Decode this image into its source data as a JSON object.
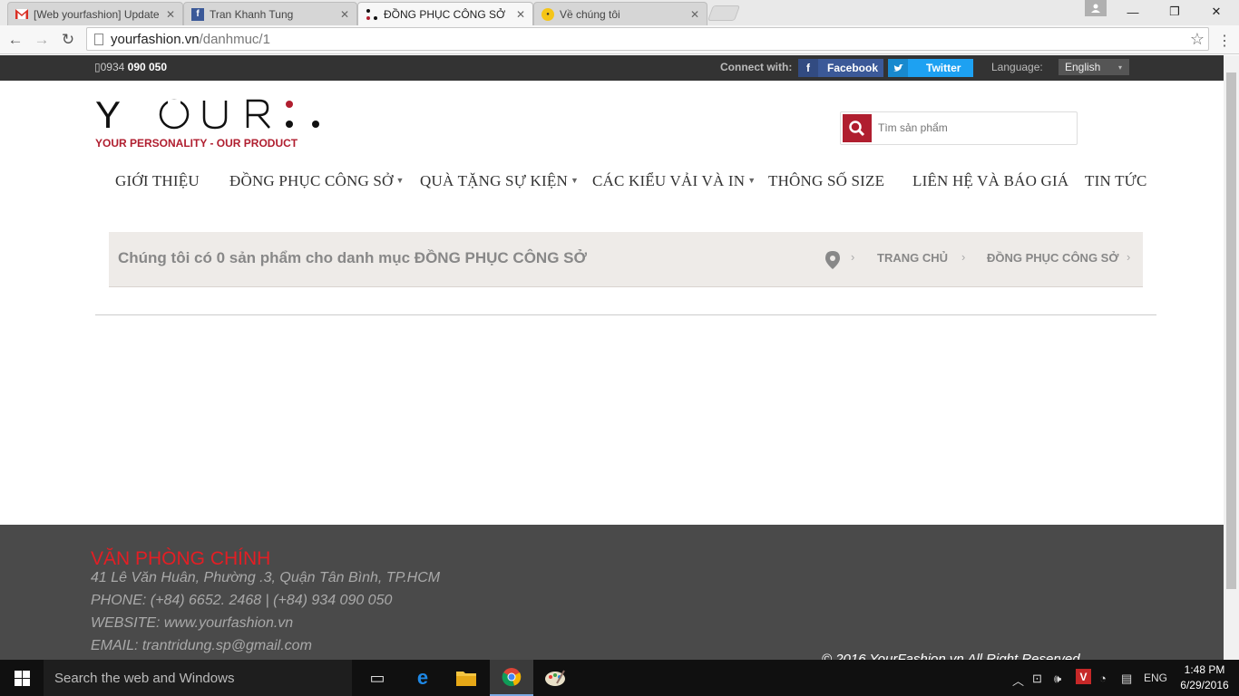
{
  "browser": {
    "tabs": [
      {
        "label": "[Web yourfashion] Update",
        "icon": "gmail-icon"
      },
      {
        "label": "Tran Khanh Tung",
        "icon": "facebook-icon"
      },
      {
        "label": "ĐỒNG PHỤC CÔNG SỞ",
        "icon": "site-logo-icon"
      },
      {
        "label": "Về chúng tôi",
        "icon": "site-icon"
      }
    ],
    "address": {
      "host": "yourfashion.vn",
      "path": "/danhmuc/1"
    }
  },
  "topbar": {
    "phone_prefix": "0934",
    "phone_suffix": "090 050",
    "connect_label": "Connect with:",
    "facebook_label": "Facebook",
    "twitter_label": "Twitter",
    "language_label": "Language:",
    "language_value": "English"
  },
  "logo": {
    "text": "YOUR",
    "tagline": "YOUR PERSONALITY - OUR PRODUCT"
  },
  "search": {
    "placeholder": "Tìm sản phẩm"
  },
  "nav": {
    "items": [
      {
        "label": "GIỚI THIỆU"
      },
      {
        "label": "ĐỒNG PHỤC CÔNG SỞ"
      },
      {
        "label": "QUÀ TẶNG SỰ KIỆN"
      },
      {
        "label": "CÁC KIỂU VẢI VÀ IN"
      },
      {
        "label": "THÔNG SỐ SIZE"
      },
      {
        "label": "LIÊN HỆ VÀ BÁO GIÁ"
      },
      {
        "label": "TIN TỨC"
      }
    ]
  },
  "banner": {
    "text": "Chúng tôi có 0 sản phẩm cho danh mục ĐỒNG PHỤC CÔNG SỞ",
    "breadcrumb": [
      "TRANG CHỦ",
      "ĐỒNG PHỤC CÔNG SỞ"
    ]
  },
  "footer": {
    "title": "VĂN PHÒNG CHÍNH",
    "address": "41 Lê Văn Huân, Phường .3, Quận Tân Bình, TP.HCM",
    "phone": "PHONE: (+84) 6652. 2468 | (+84) 934 090 050",
    "website": "WEBSITE: www.yourfashion.vn",
    "email": "EMAIL: trantridung.sp@gmail.com",
    "copyright": "© 2016 YourFashion.vn All Right Reserved"
  },
  "taskbar": {
    "search_placeholder": "Search the web and Windows",
    "language": "ENG",
    "time": "1:48 PM",
    "date": "6/29/2016"
  },
  "colors": {
    "brand": "#b01e2f",
    "footer_title": "#e31e24",
    "topbar": "#333333",
    "footer": "#4a4a4a"
  }
}
